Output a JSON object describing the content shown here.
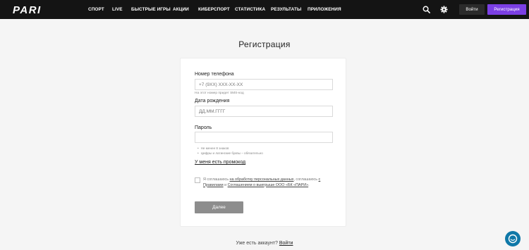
{
  "header": {
    "logo_text": "PARI",
    "nav": [
      "СПОРТ",
      "LIVE",
      "БЫСТРЫЕ ИГРЫ",
      "АКЦИИ",
      "КИБЕРСПОРТ",
      "СТАТИСТИКА",
      "РЕЗУЛЬТАТЫ",
      "ПРИЛОЖЕНИЯ"
    ],
    "login_label": "Войти",
    "register_label": "Регистрация",
    "icons": [
      "search-icon",
      "gear-icon"
    ]
  },
  "page": {
    "title": "Регистрация"
  },
  "form": {
    "phone_label": "Номер телефона",
    "phone_placeholder": "+7 (9XX) XXX-XX-XX",
    "phone_hint": "На этот номер придет SMS-код",
    "birth_label": "Дата рождения",
    "birth_placeholder": "ДД.ММ.ГГГГ",
    "password_label": "Пароль",
    "password_rules": [
      "Не менее 8 знаков",
      "Цифры и латинские буквы – обязательно"
    ],
    "promo_link": "У меня есть промокод",
    "consent": {
      "part1": "Я соглашаюсь ",
      "link1": "на обработку персональных данных",
      "part2": ", соглашаюсь ",
      "link2": "с Правилами",
      "part3": " и ",
      "link3": "Соглашением о выигрыше ООО «БК «ПАРИ»",
      "part4": "."
    },
    "submit_label": "Далее"
  },
  "footer": {
    "have_account": "Уже есть аккаунт?",
    "login_link": "Войти"
  },
  "colors": {
    "header_bg": "#141414",
    "accent": "#7b3fe4",
    "submit_disabled": "#8d8d8d",
    "chat": "#0f78a8"
  }
}
